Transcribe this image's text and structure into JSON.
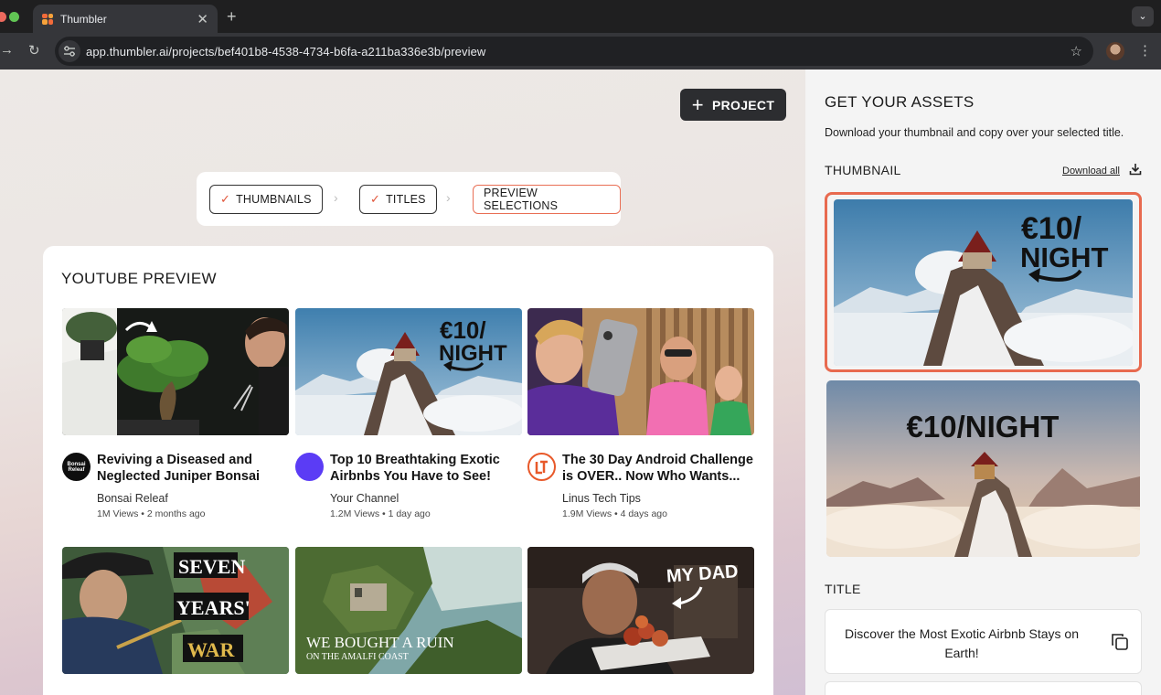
{
  "browser": {
    "tab_title": "Thumbler",
    "url": "app.thumbler.ai/projects/bef401b8-4538-4734-b6fa-a211ba336e3b/preview"
  },
  "header": {
    "project_button": "PROJECT"
  },
  "steps": [
    {
      "label": "THUMBNAILS",
      "done": true
    },
    {
      "label": "TITLES",
      "done": true
    },
    {
      "label": "PREVIEW SELECTIONS",
      "done": false,
      "active": true
    }
  ],
  "preview": {
    "heading": "YOUTUBE PREVIEW",
    "videos": [
      {
        "title": "Reviving a Diseased and Neglected Juniper Bonsai",
        "channel": "Bonsai Releaf",
        "stats": "1M Views • 2 months ago",
        "avatar_text": "Bonsai Releaf"
      },
      {
        "title": "Top 10 Breathtaking Exotic Airbnbs You Have to See!",
        "channel": "Your Channel",
        "stats": "1.2M Views • 1 day ago",
        "thumb_text_1": "€10/",
        "thumb_text_2": "NIGHT"
      },
      {
        "title": "The 30 Day Android Challenge is OVER.. Now Who Wants...",
        "channel": "Linus Tech Tips",
        "stats": "1.9M Views • 4 days ago"
      },
      {
        "thumb_text_1": "SEVEN",
        "thumb_text_2": "YEARS'",
        "thumb_text_3": "WAR"
      },
      {
        "thumb_text_1": "WE BOUGHT A RUIN",
        "thumb_text_2": "ON THE AMALFI COAST"
      },
      {
        "thumb_text_1": "MY DAD"
      }
    ]
  },
  "assets": {
    "heading": "GET YOUR ASSETS",
    "description": "Download your thumbnail and copy over your selected title.",
    "thumbnail_label": "THUMBNAIL",
    "download_all": "Download all",
    "thumb1_text_1": "€10/",
    "thumb1_text_2": "NIGHT",
    "thumb2_text": "€10/NIGHT",
    "title_label": "TITLE",
    "selected_title": "Discover the Most Exotic Airbnb Stays on Earth!"
  },
  "colors": {
    "accent": "#e86a4f",
    "dark_button": "#2c2d30",
    "your_channel_avatar": "#5b3cf5"
  }
}
